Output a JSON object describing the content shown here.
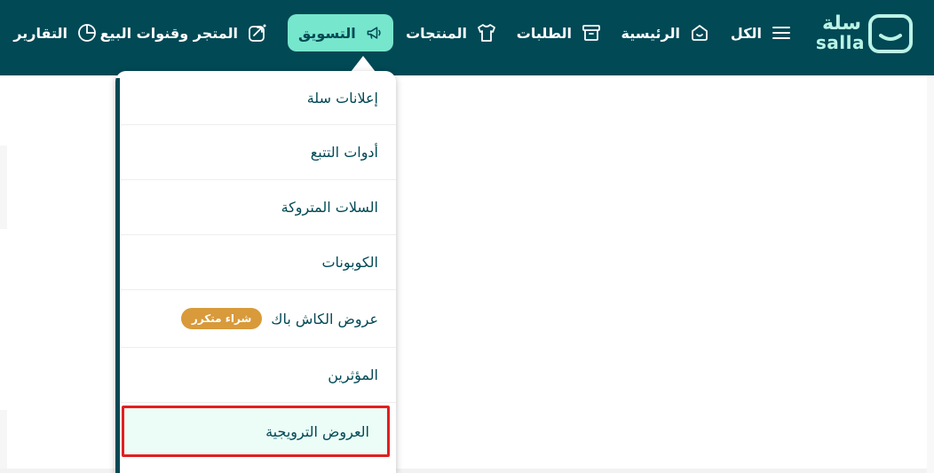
{
  "brand": {
    "name_ar": "سلة",
    "name_en": "salla",
    "colors": {
      "topbar": "#004955",
      "accent": "#76e6cc",
      "badge": "#d89a3a",
      "highlight_border": "#e21f1f"
    }
  },
  "nav": {
    "items": [
      {
        "label": "الكل",
        "icon": "menu-lines-icon"
      },
      {
        "label": "الرئيسية",
        "icon": "home-icon"
      },
      {
        "label": "الطلبات",
        "icon": "archive-box-icon"
      },
      {
        "label": "المنتجات",
        "icon": "tshirt-icon"
      },
      {
        "label": "التسويق",
        "icon": "megaphone-icon",
        "active": true
      },
      {
        "label": "المتجر وقنوات البيع",
        "icon": "share-store-icon"
      },
      {
        "label": "التقارير",
        "icon": "pie-chart-icon"
      }
    ]
  },
  "marketing_menu": {
    "items": [
      {
        "label": "إعلانات سلة"
      },
      {
        "label": "أدوات التتبع"
      },
      {
        "label": "السلات المتروكة"
      },
      {
        "label": "الكوبونات"
      },
      {
        "label": "عروض الكاش باك",
        "badge": "شراء متكرر"
      },
      {
        "label": "المؤثرين"
      },
      {
        "label": "العروض الترويجية",
        "selected": true
      }
    ]
  }
}
